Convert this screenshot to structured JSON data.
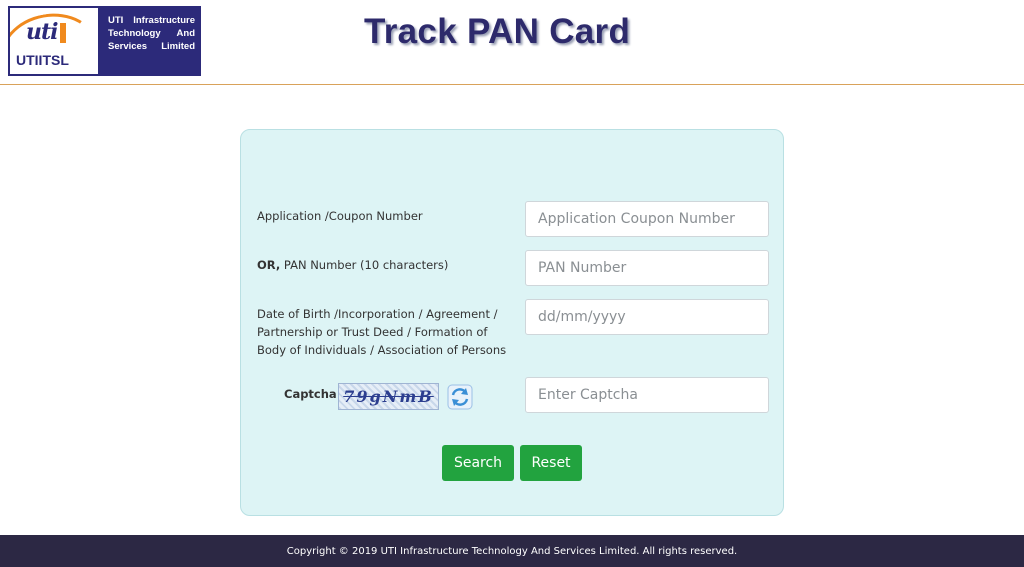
{
  "header": {
    "logo": {
      "mark": "uti",
      "brand": "UTIITSL",
      "org_lines": [
        [
          "UTI",
          "Infrastructure"
        ],
        [
          "Technology",
          "And"
        ],
        [
          "Services",
          "Limited"
        ]
      ]
    },
    "title": "Track PAN Card"
  },
  "form": {
    "application_label": "Application /Coupon Number",
    "application_placeholder": "Application Coupon Number",
    "pan_label_prefix": "OR,",
    "pan_label": " PAN Number (10 characters)",
    "pan_placeholder": "PAN Number",
    "dob_label_lines": [
      "Date of Birth /Incorporation / Agreement /",
      "Partnership or Trust Deed / Formation of",
      "Body of Individuals / Association of Persons"
    ],
    "dob_placeholder": "dd/mm/yyyy",
    "captcha_label": "Captcha",
    "captcha_text": "79gNmB",
    "captcha_placeholder": "Enter Captcha",
    "search_label": "Search",
    "reset_label": "Reset"
  },
  "footer": {
    "copyright": "Copyright © 2019 UTI Infrastructure Technology And Services Limited. All rights reserved."
  },
  "colors": {
    "brand_navy": "#2c2a7a",
    "brand_orange": "#f08a1e",
    "card_bg": "#ddf4f5",
    "button_green": "#22a33f",
    "footer_bg": "#2c2844"
  }
}
